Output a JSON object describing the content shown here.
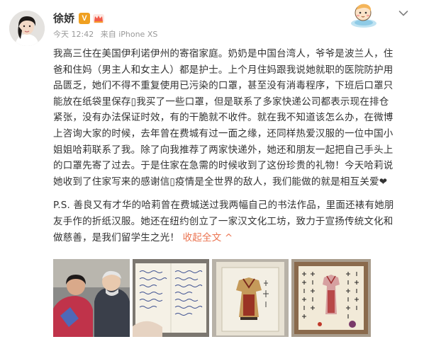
{
  "post": {
    "author": "徐娇",
    "verified_badge": "V",
    "time": "今天 12:42",
    "source": "来自 iPhone XS",
    "paragraph1_lines": [
      "我高三住在美国伊利诺伊州的寄宿家庭。奶奶是中国台湾人，爷爷是波兰人，住",
      "爸和住妈（男主人和女主人）都是护士。上个月住妈跟我说她就职的医院防护用",
      "品匮乏，她们不得不重复使用已污染的口罩，甚至没有消毒程序，下班后口罩只",
      "能放在纸袋里保存▯我买了一些口罩，但是联系了多家快递公司都表示现在排仓",
      "紧张，没有办法保证时效，有的干脆就不收件。就在我不知道该怎么办，在微博",
      "上咨询大家的时候，去年曾在费城有过一面之缘，还同样热爱汉服的一位中国小",
      "姐姐哈莉联系了我。除了向我推荐了两家快递外，她还和朋友一起把自己手头上",
      "的口罩先寄了过去。于是住家在急需的时候收到了这份珍贵的礼物！今天哈莉说",
      "她收到了住家写来的感谢信▯疫情是全世界的敌人，我们能做的就是相互关爱❤"
    ],
    "paragraph2_lines": [
      "P.S. 善良又有才华的哈莉曾在费城送过我两幅自己的书法作品，里面还裱有她朋",
      "友手作的折纸汉服。她还在纽约创立了一家汉文化工坊，致力于宣扬传统文化和",
      "做慈善，是我们留学生之光！"
    ],
    "expand_label": "收起全文 ^"
  },
  "colors": {
    "link": "#eb7350",
    "meta": "#999999",
    "badge": "#f0a020",
    "text": "#333333"
  },
  "icons": {
    "verified": "v-badge-icon",
    "member": "crown-icon",
    "mascot": "mascot-sticker-icon",
    "more": "chevron-down-icon"
  },
  "photos": [
    "couple-photo",
    "handwritten-card-photo",
    "framed-paper-hanfu-photo",
    "calligraphy-artwork-photo"
  ]
}
